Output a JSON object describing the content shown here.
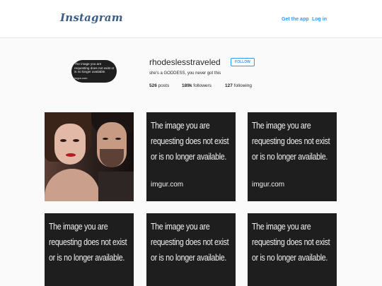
{
  "header": {
    "logo": "Instagram",
    "get_app": "Get the app",
    "log_in": "Log in"
  },
  "profile": {
    "avatar_text": "The image you are requesting does not exist or is no longer available.",
    "avatar_brand": "imgur.com",
    "username": "rhodeslesstraveled",
    "follow_label": "FOLLOW",
    "bio": "she's a GODDESS, you never got this",
    "posts_count": "526",
    "posts_label": "posts",
    "followers_count": "189k",
    "followers_label": "followers",
    "following_count": "127",
    "following_label": "following"
  },
  "grid": {
    "missing_line1": "The image you are",
    "missing_line2": "requesting does not exist",
    "missing_line3": "or is no longer available.",
    "missing_brand": "imgur.com"
  }
}
